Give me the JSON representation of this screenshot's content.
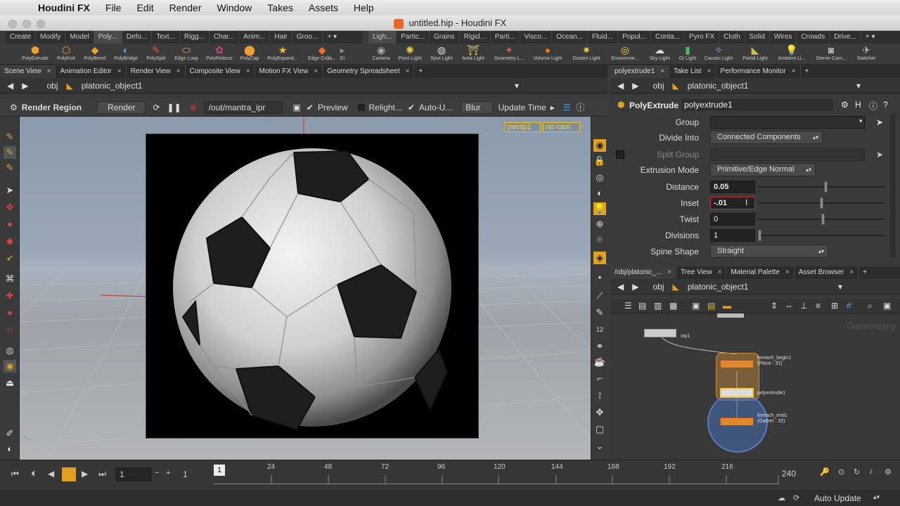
{
  "menubar": {
    "app_name": "Houdini FX",
    "items": [
      "File",
      "Edit",
      "Render",
      "Window",
      "Takes",
      "Assets",
      "Help"
    ]
  },
  "window": {
    "title": "untitled.hip - Houdini FX"
  },
  "shelf_left": {
    "tabs": [
      "Create",
      "Modify",
      "Model",
      "Poly...",
      "Defo...",
      "Text...",
      "Rigg...",
      "Char...",
      "Anim...",
      "Hair",
      "Groo..."
    ],
    "tools": [
      {
        "label": "PolyExtrude",
        "icon": "polyextrude-icon"
      },
      {
        "label": "PolyKnit",
        "icon": "polyknit-icon"
      },
      {
        "label": "PolyBevel",
        "icon": "polybevel-icon"
      },
      {
        "label": "PolyBridge",
        "icon": "polybridge-icon"
      },
      {
        "label": "PolySplit",
        "icon": "polysplit-icon"
      },
      {
        "label": "Edge Loop",
        "icon": "edge-loop-icon"
      },
      {
        "label": "PolyReduce",
        "icon": "polyreduce-icon"
      },
      {
        "label": "PolyCap",
        "icon": "polycap-icon"
      },
      {
        "label": "PolyExpand...",
        "icon": "polyexpand-icon"
      },
      {
        "label": "Edge Colla...",
        "icon": "edge-collapse-icon"
      },
      {
        "label": "Ei",
        "icon": "edge-icon"
      }
    ]
  },
  "shelf_right": {
    "tabs": [
      "Ligh...",
      "Partic...",
      "Grains",
      "Rigid...",
      "Parti...",
      "Visco...",
      "Ocean...",
      "Fluid...",
      "Popul...",
      "Conta...",
      "Pyro FX",
      "Cloth",
      "Solid",
      "Wires",
      "Crowds",
      "Drive..."
    ],
    "tools": [
      {
        "label": "Camera",
        "icon": "camera-icon"
      },
      {
        "label": "Point Light",
        "icon": "point-light-icon"
      },
      {
        "label": "Spot Light",
        "icon": "spot-light-icon"
      },
      {
        "label": "Area Light",
        "icon": "area-light-icon"
      },
      {
        "label": "Geometry L...",
        "icon": "geometry-light-icon"
      },
      {
        "label": "Volume Light",
        "icon": "volume-light-icon"
      },
      {
        "label": "Distant Light",
        "icon": "distant-light-icon"
      },
      {
        "label": "Environme...",
        "icon": "environment-light-icon"
      },
      {
        "label": "Sky Light",
        "icon": "sky-light-icon"
      },
      {
        "label": "GI Light",
        "icon": "gi-light-icon"
      },
      {
        "label": "Caustic Light",
        "icon": "caustic-light-icon"
      },
      {
        "label": "Portal Light",
        "icon": "portal-light-icon"
      },
      {
        "label": "Ambient Li...",
        "icon": "ambient-light-icon"
      },
      {
        "label": "Stereo Cam...",
        "icon": "stereo-camera-icon"
      },
      {
        "label": "Switcher",
        "icon": "switcher-icon"
      }
    ]
  },
  "left_pane": {
    "tabs": [
      "Scene View",
      "Animation Editor",
      "Render View",
      "Composite View",
      "Motion FX View",
      "Geometry Spreadsheet"
    ],
    "path": {
      "root": "obj",
      "node": "platonic_object1"
    },
    "render_bar": {
      "region_label": "Render Region",
      "render_button": "Render",
      "output": "/out/mantra_ipr",
      "preview": "Preview",
      "relight": "Relight...",
      "auto_update": "Auto-U...",
      "blur": "Blur",
      "update_time": "Update Time"
    },
    "viewport": {
      "camera_menu": "persp1",
      "cam_menu": "no cam"
    }
  },
  "params_pane": {
    "tabs": [
      "polyextrude1",
      "Take List",
      "Performance Monitor"
    ],
    "path": {
      "root": "obj",
      "node": "platonic_object1"
    },
    "node_type": "PolyExtrude",
    "node_name": "polyextrude1",
    "rows": {
      "group": {
        "label": "Group",
        "value": ""
      },
      "divide_into": {
        "label": "Divide Into",
        "value": "Connected Components"
      },
      "split_group": {
        "label": "Split Group",
        "value": ""
      },
      "extrusion_mode": {
        "label": "Extrusion Mode",
        "value": "Primitive/Edge Normal"
      },
      "distance": {
        "label": "Distance",
        "value": "0.05",
        "slider_fraction": 0.52
      },
      "inset": {
        "label": "Inset",
        "value": "-.01",
        "slider_fraction": 0.49
      },
      "twist": {
        "label": "Twist",
        "value": "0",
        "slider_fraction": 0.5
      },
      "divisions": {
        "label": "Divisions",
        "value": "1",
        "slider_fraction": 0.0
      },
      "spine_shape": {
        "label": "Spine Shape",
        "value": "Straight"
      }
    }
  },
  "network_pane": {
    "tabs": [
      "/obj/platonic_...",
      "Tree View",
      "Material Palette",
      "Asset Browser"
    ],
    "path": {
      "root": "obj",
      "node": "platonic_object1"
    },
    "context_label": "Geometry",
    "nodes": {
      "ray": {
        "label": "ray1"
      },
      "foreach_begin": {
        "label": "foreach_begin1",
        "sublabel": "(Piece : 31)"
      },
      "polyextrude": {
        "label": "polyextrude1"
      },
      "foreach_end": {
        "label": "foreach_end1",
        "sublabel": "(Gather : 32)"
      }
    }
  },
  "timeline": {
    "current_frame": "1",
    "start_frame": "1",
    "end_frame": "240",
    "playhead_frame": "1",
    "ticks": [
      "24",
      "48",
      "72",
      "96",
      "120",
      "144",
      "168",
      "192",
      "216"
    ]
  },
  "statusbar": {
    "auto_update": "Auto Update"
  },
  "colors": {
    "accent": "#e0a020",
    "selection": "#f5c542",
    "bg": "#3a3a3a"
  }
}
